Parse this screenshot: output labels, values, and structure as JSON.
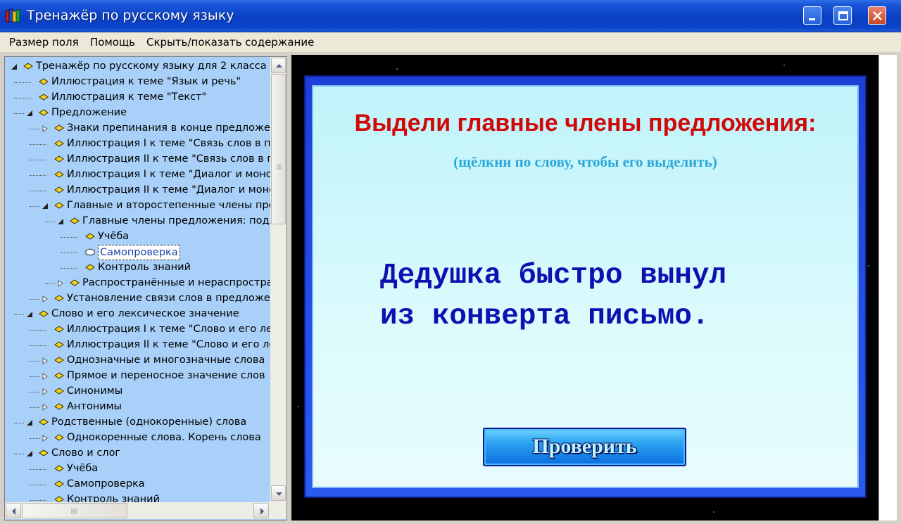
{
  "window": {
    "title": "Тренажёр по русскому языку"
  },
  "menu": {
    "items": [
      "Размер поля",
      "Помощь",
      "Скрыть/показать содержание"
    ]
  },
  "tree": {
    "rows": [
      {
        "label": "Тренажёр по русскому языку для 2 класса",
        "level": 0,
        "expander": "open",
        "icon": "book-icon"
      },
      {
        "label": "Иллюстрация к теме \"Язык и речь\"",
        "level": 1,
        "expander": "none",
        "icon": "book-icon"
      },
      {
        "label": "Иллюстрация к теме \"Текст\"",
        "level": 1,
        "expander": "none",
        "icon": "book-icon"
      },
      {
        "label": "Предложение",
        "level": 1,
        "expander": "open",
        "icon": "book-icon"
      },
      {
        "label": "Знаки препинания в конце предложения",
        "level": 2,
        "expander": "closed",
        "icon": "book-icon"
      },
      {
        "label": "Иллюстрация I к теме \"Связь слов в предложении\"",
        "level": 2,
        "expander": "none",
        "icon": "book-icon"
      },
      {
        "label": "Иллюстрация II к теме \"Связь слов в предложении\"",
        "level": 2,
        "expander": "none",
        "icon": "book-icon"
      },
      {
        "label": "Иллюстрация I к теме \"Диалог и монолог\"",
        "level": 2,
        "expander": "none",
        "icon": "book-icon"
      },
      {
        "label": "Иллюстрация II к теме \"Диалог и монолог\"",
        "level": 2,
        "expander": "none",
        "icon": "book-icon"
      },
      {
        "label": "Главные и второстепенные члены предложения",
        "level": 2,
        "expander": "open",
        "icon": "book-icon"
      },
      {
        "label": "Главные члены предложения: подлежащее и сказуемое",
        "level": 3,
        "expander": "open",
        "icon": "book-icon"
      },
      {
        "label": "Учёба",
        "level": 4,
        "expander": "none",
        "icon": "book-icon"
      },
      {
        "label": "Самопроверка",
        "level": 4,
        "expander": "none",
        "icon": "open-book-icon",
        "selected": true
      },
      {
        "label": "Контроль знаний",
        "level": 4,
        "expander": "none",
        "icon": "book-icon"
      },
      {
        "label": "Распространённые и нераспространённые предложения",
        "level": 3,
        "expander": "closed",
        "icon": "book-icon"
      },
      {
        "label": "Установление связи слов в предложении",
        "level": 2,
        "expander": "closed",
        "icon": "book-icon"
      },
      {
        "label": "Слово и его лексическое значение",
        "level": 1,
        "expander": "open",
        "icon": "book-icon"
      },
      {
        "label": "Иллюстрация I к теме \"Слово и его лексическое значение\"",
        "level": 2,
        "expander": "none",
        "icon": "book-icon"
      },
      {
        "label": "Иллюстрация II к теме \"Слово и его лексическое значение\"",
        "level": 2,
        "expander": "none",
        "icon": "book-icon"
      },
      {
        "label": "Однозначные и многозначные слова",
        "level": 2,
        "expander": "closed",
        "icon": "book-icon"
      },
      {
        "label": "Прямое и переносное значение слов",
        "level": 2,
        "expander": "closed",
        "icon": "book-icon"
      },
      {
        "label": "Синонимы",
        "level": 2,
        "expander": "closed",
        "icon": "book-icon"
      },
      {
        "label": "Антонимы",
        "level": 2,
        "expander": "closed",
        "icon": "book-icon"
      },
      {
        "label": "Родственные (однокоренные) слова",
        "level": 1,
        "expander": "open",
        "icon": "book-icon"
      },
      {
        "label": "Однокоренные слова. Корень слова",
        "level": 2,
        "expander": "closed",
        "icon": "book-icon"
      },
      {
        "label": "Слово и слог",
        "level": 1,
        "expander": "open",
        "icon": "book-icon"
      },
      {
        "label": "Учёба",
        "level": 2,
        "expander": "none",
        "icon": "book-icon"
      },
      {
        "label": "Самопроверка",
        "level": 2,
        "expander": "none",
        "icon": "book-icon"
      },
      {
        "label": "Контроль знаний",
        "level": 2,
        "expander": "none",
        "icon": "book-icon"
      }
    ]
  },
  "exercise": {
    "heading": "Выдели главные члены предложения:",
    "subheading": "(щёлкни по слову, чтобы его выделить)",
    "sentence_words": [
      "Дедушка",
      "быстро",
      "вынул",
      "из",
      "конверта",
      "письмо."
    ],
    "check_button": "Проверить"
  },
  "colors": {
    "heading": "#d00808",
    "subheading": "#2aa7d8",
    "sentence": "#1010b0",
    "tree_background": "#a8d0f8"
  }
}
